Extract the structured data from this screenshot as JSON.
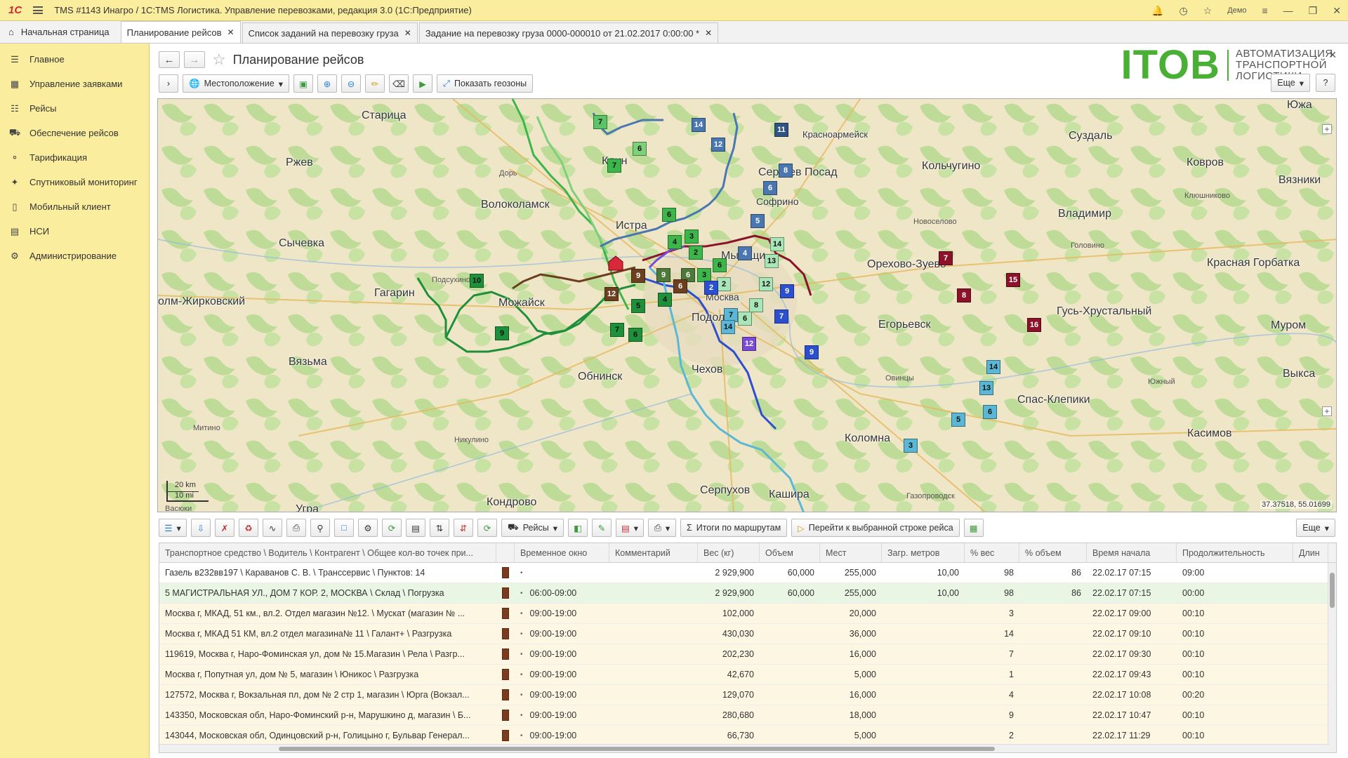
{
  "titlebar": {
    "logo": "1С",
    "title": "TMS #1143 Инагро / 1С:TMS Логистика. Управление перевозками, редакция 3.0  (1С:Предприятие)",
    "user": "Демо"
  },
  "tabs": {
    "home": "Начальная страница",
    "items": [
      {
        "label": "Планирование рейсов"
      },
      {
        "label": "Список заданий на перевозку груза"
      },
      {
        "label": "Задание на перевозку груза 0000-000010 от 21.02.2017 0:00:00 *"
      }
    ]
  },
  "sidebar": {
    "items": [
      {
        "label": "Главное",
        "icon": "menu-icon"
      },
      {
        "label": "Управление заявками",
        "icon": "grid-icon"
      },
      {
        "label": "Рейсы",
        "icon": "calendar-icon"
      },
      {
        "label": "Обеспечение рейсов",
        "icon": "truck-icon"
      },
      {
        "label": "Тарификация",
        "icon": "tariff-icon"
      },
      {
        "label": "Спутниковый мониторинг",
        "icon": "satellite-icon"
      },
      {
        "label": "Мобильный клиент",
        "icon": "phone-icon"
      },
      {
        "label": "НСИ",
        "icon": "books-icon"
      },
      {
        "label": "Администрирование",
        "icon": "gear-icon"
      }
    ]
  },
  "page": {
    "title": "Планирование рейсов",
    "more": "Еще",
    "help": "?"
  },
  "brand": {
    "name": "ITOB",
    "tagline": "АВТОМАТИЗАЦИЯ ТРАНСПОРТНОЙ ЛОГИСТИКИ"
  },
  "toolbar1": {
    "location": "Местоположение",
    "geozones": "Показать геозоны"
  },
  "map": {
    "coords": "37.37518, 55.01699",
    "scale_km": "20 km",
    "scale_mi": "10 mi",
    "cities": [
      {
        "name": "Старица"
      },
      {
        "name": "Ржев"
      },
      {
        "name": "Волоколамск"
      },
      {
        "name": "Сычевка"
      },
      {
        "name": "Истра"
      },
      {
        "name": "Гагарин"
      },
      {
        "name": "олм-Жирковский"
      },
      {
        "name": "Можайск"
      },
      {
        "name": "Вязьма"
      },
      {
        "name": "Обнинск"
      },
      {
        "name": "Чехов"
      },
      {
        "name": "Серпухов"
      },
      {
        "name": "Подольск"
      },
      {
        "name": "Кондрово"
      },
      {
        "name": "Клин"
      },
      {
        "name": "Сергиев Посад"
      },
      {
        "name": "Красноармейск"
      },
      {
        "name": "Софрино"
      },
      {
        "name": "Мытищи"
      },
      {
        "name": "Москва"
      },
      {
        "name": "Орехово-Зуево"
      },
      {
        "name": "Егорьевск"
      },
      {
        "name": "Коломна"
      },
      {
        "name": "Кашира"
      },
      {
        "name": "Суздаль"
      },
      {
        "name": "Ковров"
      },
      {
        "name": "Вязники"
      },
      {
        "name": "Кольчугино"
      },
      {
        "name": "Владимир"
      },
      {
        "name": "Красная Горбатка"
      },
      {
        "name": "Гусь-Хрустальный"
      },
      {
        "name": "Муром"
      },
      {
        "name": "Выкса"
      },
      {
        "name": "Спас-Клепики"
      },
      {
        "name": "Касимов"
      },
      {
        "name": "Южа"
      },
      {
        "name": "Угра"
      }
    ],
    "towns": [
      {
        "name": "Дорь"
      },
      {
        "name": "Подсухино"
      },
      {
        "name": "Новоселово"
      },
      {
        "name": "Клюшниково"
      },
      {
        "name": "Головино"
      },
      {
        "name": "Овинцы"
      },
      {
        "name": "Южный"
      },
      {
        "name": "Митино"
      },
      {
        "name": "Никулино"
      },
      {
        "name": "Газопроводск"
      },
      {
        "name": "Васюки"
      }
    ],
    "markers": [
      {
        "n": "7"
      },
      {
        "n": "6"
      },
      {
        "n": "7"
      },
      {
        "n": "6"
      },
      {
        "n": "3"
      },
      {
        "n": "4"
      },
      {
        "n": "2"
      },
      {
        "n": "6"
      },
      {
        "n": "9"
      },
      {
        "n": "6"
      },
      {
        "n": "3"
      },
      {
        "n": "10"
      },
      {
        "n": "5"
      },
      {
        "n": "7"
      },
      {
        "n": "6"
      },
      {
        "n": "9"
      },
      {
        "n": "10"
      },
      {
        "n": "9"
      },
      {
        "n": "12"
      },
      {
        "n": "6"
      },
      {
        "n": "4"
      },
      {
        "n": "14"
      },
      {
        "n": "12"
      },
      {
        "n": "11"
      },
      {
        "n": "8"
      },
      {
        "n": "6"
      },
      {
        "n": "5"
      },
      {
        "n": "4"
      },
      {
        "n": "14"
      },
      {
        "n": "13"
      },
      {
        "n": "2"
      },
      {
        "n": "12"
      },
      {
        "n": "6"
      },
      {
        "n": "7"
      },
      {
        "n": "8"
      },
      {
        "n": "9"
      },
      {
        "n": "9"
      },
      {
        "n": "7"
      },
      {
        "n": "6"
      },
      {
        "n": "14"
      },
      {
        "n": "12"
      },
      {
        "n": "7"
      },
      {
        "n": "8"
      },
      {
        "n": "9"
      },
      {
        "n": "15"
      },
      {
        "n": "16"
      },
      {
        "n": "14"
      },
      {
        "n": "13"
      },
      {
        "n": "5"
      },
      {
        "n": "6"
      },
      {
        "n": "3"
      },
      {
        "n": "2"
      }
    ]
  },
  "toolbar2": {
    "reisy": "Рейсы",
    "totals": "Итоги по маршрутам",
    "goto": "Перейти к выбранной строке рейса",
    "more": "Еще"
  },
  "table": {
    "columns": [
      "Транспортное средство \\ Водитель \\ Контрагент \\ Общее кол-во точек при...",
      "",
      "Временное окно",
      "Комментарий",
      "Вес (кг)",
      "Объем",
      "Мест",
      "Загр. метров",
      "% вес",
      "% объем",
      "Время начала",
      "Продолжительность",
      "Длин"
    ],
    "rows": [
      [
        "Газель в232вв197 \\ Караванов С. В. \\ Транссервис \\ Пунктов: 14",
        "",
        "",
        "2 929,900",
        "60,000",
        "255,000",
        "10,00",
        "98",
        "86",
        "22.02.17 07:15",
        "09:00"
      ],
      [
        "5 МАГИСТРАЛЬНАЯ УЛ., ДОМ 7 КОР. 2, МОСКВА \\ Склад \\ Погрузка",
        "06:00-09:00",
        "",
        "2 929,900",
        "60,000",
        "255,000",
        "10,00",
        "98",
        "86",
        "22.02.17 07:15",
        "00:00"
      ],
      [
        "Москва г, МКАД, 51 км., вл.2. Отдел магазин №12. \\ Мускат (магазин № ...",
        "09:00-19:00",
        "",
        "102,000",
        "",
        "20,000",
        "",
        "3",
        "",
        "22.02.17 09:00",
        "00:10"
      ],
      [
        "Москва г, МКАД 51 КМ, вл.2 отдел магазина№ 11 \\ Галант+ \\ Разгрузка",
        "09:00-19:00",
        "",
        "430,030",
        "",
        "36,000",
        "",
        "14",
        "",
        "22.02.17 09:10",
        "00:10"
      ],
      [
        "119619, Москва г, Наро-Фоминская ул, дом № 15.Магазин \\ Рела \\ Разгр...",
        "09:00-19:00",
        "",
        "202,230",
        "",
        "16,000",
        "",
        "7",
        "",
        "22.02.17 09:30",
        "00:10"
      ],
      [
        "Москва г, Попутная ул, дом № 5, магазин \\ Юникос \\ Разгрузка",
        "09:00-19:00",
        "",
        "42,670",
        "",
        "5,000",
        "",
        "1",
        "",
        "22.02.17 09:43",
        "00:10"
      ],
      [
        "127572, Москва г, Вокзальная пл, дом № 2 стр 1, магазин \\ Юрга (Вокзал...",
        "09:00-19:00",
        "",
        "129,070",
        "",
        "16,000",
        "",
        "4",
        "",
        "22.02.17 10:08",
        "00:20"
      ],
      [
        "143350, Московская обл, Наро-Фоминский р-н, Марушкино д, магазин \\ Б...",
        "09:00-19:00",
        "",
        "280,680",
        "",
        "18,000",
        "",
        "9",
        "",
        "22.02.17 10:47",
        "00:10"
      ],
      [
        "143044, Московская обл, Одинцовский р-н, Голицыно г, Бульвар Генерал...",
        "09:00-19:00",
        "",
        "66,730",
        "",
        "5,000",
        "",
        "2",
        "",
        "22.02.17 11:29",
        "00:10"
      ]
    ]
  }
}
